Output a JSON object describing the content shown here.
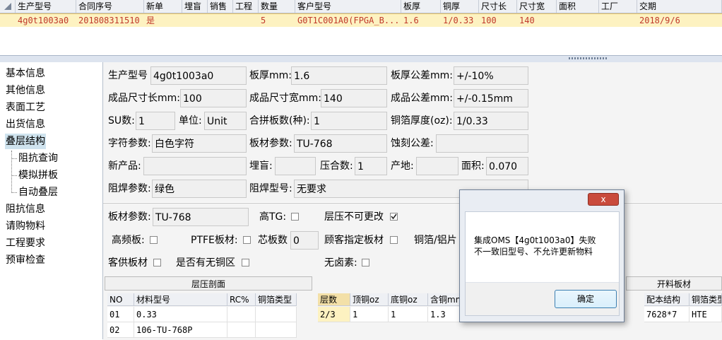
{
  "grid": {
    "headers": [
      "生产型号",
      "合同序号",
      "新单",
      "埋盲",
      "销售",
      "工程",
      "数量",
      "客户型号",
      "板厚",
      "铜厚",
      "尺寸长",
      "尺寸宽",
      "面积",
      "工厂",
      "交期"
    ],
    "row": [
      "4g0t1003a0",
      "201808311510",
      "是",
      "",
      "",
      "",
      "5",
      "G0T1C001A0(FPGA_B...",
      "1.6",
      "1/0.33",
      "100",
      "140",
      "",
      "",
      "2018/9/6"
    ]
  },
  "nav": {
    "items": [
      "基本信息",
      "其他信息",
      "表面工艺",
      "出货信息",
      "叠层结构",
      "阻抗查询",
      "模拟拼板",
      "自动叠层",
      "阻抗信息",
      "请购物料",
      "工程要求",
      "预审检查"
    ]
  },
  "form": {
    "production_model": {
      "label": "生产型号",
      "value": "4g0t1003a0"
    },
    "thickness": {
      "label": "板厚mm:",
      "value": "1.6"
    },
    "thickness_tol": {
      "label": "板厚公差mm:",
      "value": "+/-10%"
    },
    "finished_len": {
      "label": "成品尺寸长mm:",
      "value": "100"
    },
    "finished_wid": {
      "label": "成品尺寸宽mm:",
      "value": "140"
    },
    "finished_tol": {
      "label": "成品公差mm:",
      "value": "+/-0.15mm"
    },
    "su_count": {
      "label": "SU数:",
      "value": "1"
    },
    "unit": {
      "label": "单位:",
      "value": "Unit"
    },
    "panel_types": {
      "label": "合拼板数(种):",
      "value": "1"
    },
    "copper_oz": {
      "label": "铜箔厚度(oz):",
      "value": "1/0.33"
    },
    "char_param": {
      "label": "字符参数:",
      "value": "白色字符"
    },
    "board_param": {
      "label": "板材参数:",
      "value": "TU-768"
    },
    "etch_tol": {
      "label": "蚀刻公差:",
      "value": ""
    },
    "new_product": {
      "label": "新产品:",
      "value": ""
    },
    "buried_blind": {
      "label": "埋盲:",
      "value": ""
    },
    "press_count": {
      "label": "压合数:",
      "value": "1"
    },
    "origin": {
      "label": "产地:",
      "value": ""
    },
    "area": {
      "label": "面积:",
      "value": "0.070"
    },
    "solder_param": {
      "label": "阻焊参数:",
      "value": "绿色"
    },
    "solder_model": {
      "label": "阻焊型号:",
      "value": "无要求"
    }
  },
  "panel2": {
    "board_param": {
      "label": "板材参数:",
      "value": "TU-768"
    },
    "high_tg": "高TG:",
    "no_change": "层压不可更改",
    "high_freq": "高频板:",
    "ptfe": "PTFE板材:",
    "core_count": {
      "label": "芯板数",
      "value": "0"
    },
    "cust_board": "顾客指定板材",
    "copper_al": "铜箔/铝片",
    "cust_supply": "客供板材",
    "no_copper": "是否有无铜区",
    "halogen_free": "无卤素:"
  },
  "tables": {
    "stack_title": "层压剖面",
    "stack_headers": [
      "NO",
      "材料型号",
      "RC%",
      "铜箔类型"
    ],
    "stack_rows": [
      [
        "01",
        "0.33",
        "",
        ""
      ],
      [
        "02",
        "106-TU-768P",
        "",
        ""
      ]
    ],
    "layer_headers": [
      "层数",
      "顶铜oz",
      "底铜oz",
      "含铜mm"
    ],
    "layer_rows": [
      [
        "2/3",
        "1",
        "1",
        "1.3"
      ]
    ],
    "cut_title": "开料板材",
    "cut_headers": [
      "配本结构",
      "铜箔类型"
    ],
    "cut_rows": [
      [
        "7628*7",
        "HTE"
      ]
    ]
  },
  "dialog": {
    "close": "x",
    "line1": "集成OMS【4g0t1003a0】失败",
    "line2": "不一致旧型号、不允许更新物料",
    "ok": "确定"
  }
}
